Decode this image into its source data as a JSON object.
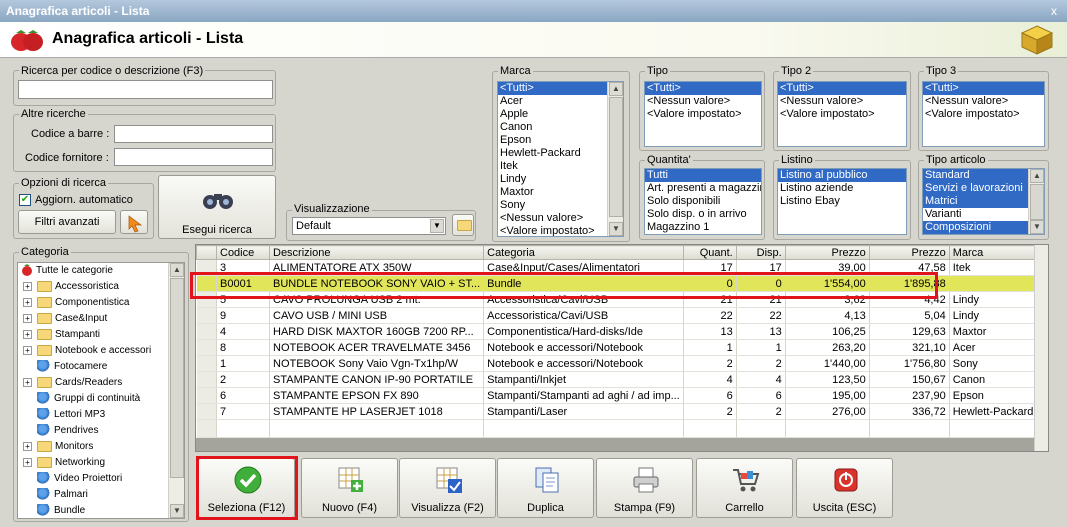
{
  "window": {
    "title": "Anagrafica articoli  - Lista",
    "close_label": "x"
  },
  "header": {
    "title": "Anagrafica articoli  - Lista"
  },
  "search": {
    "label": "Ricerca per codice o descrizione (F3)",
    "value": ""
  },
  "other_search": {
    "label": "Altre ricerche",
    "barcode_label": "Codice a barre :",
    "barcode_value": "",
    "supplier_label": "Codice fornitore :",
    "supplier_value": ""
  },
  "options": {
    "label": "Opzioni di ricerca",
    "auto_update_label": "Aggiorn. automatico",
    "auto_update_checked": true,
    "advanced_filters_label": "Filtri avanzati"
  },
  "run_search": {
    "label": "Esegui ricerca"
  },
  "view": {
    "label": "Visualizzazione",
    "selected": "Default"
  },
  "marca": {
    "label": "Marca",
    "items": [
      "<Tutti>",
      "Acer",
      "Apple",
      "Canon",
      "Epson",
      "Hewlett-Packard",
      "Itek",
      "Lindy",
      "Maxtor",
      "Sony",
      "<Nessun valore>",
      "<Valore impostato>"
    ],
    "selected_index": 0
  },
  "tipo": {
    "label": "Tipo",
    "items": [
      "<Tutti>",
      "<Nessun valore>",
      "<Valore impostato>"
    ],
    "selected_index": 0
  },
  "tipo2": {
    "label": "Tipo 2",
    "items": [
      "<Tutti>",
      "<Nessun valore>",
      "<Valore impostato>"
    ],
    "selected_index": 0
  },
  "tipo3": {
    "label": "Tipo 3",
    "items": [
      "<Tutti>",
      "<Nessun valore>",
      "<Valore impostato>"
    ],
    "selected_index": 0
  },
  "quantita": {
    "label": "Quantita'",
    "items": [
      "Tutti",
      "Art. presenti a magazzino",
      "Solo disponibili",
      "Solo disp. o in arrivo",
      "Magazzino 1"
    ],
    "selected_index": 0
  },
  "listino": {
    "label": "Listino",
    "items": [
      "Listino al pubblico",
      "Listino aziende",
      "Listino Ebay"
    ],
    "selected_index": 0
  },
  "tipo_articolo": {
    "label": "Tipo articolo",
    "items": [
      "Standard",
      "Servizi e lavorazioni",
      "Matrici",
      "Varianti",
      "Composizioni"
    ],
    "selected": [
      0,
      1,
      2,
      4
    ]
  },
  "categoria": {
    "label": "Categoria",
    "root": "Tutte le categorie",
    "items": [
      {
        "label": "Accessoristica",
        "type": "folder",
        "expandable": true
      },
      {
        "label": "Componentistica",
        "type": "folder",
        "expandable": true
      },
      {
        "label": "Case&Input",
        "type": "folder",
        "expandable": true
      },
      {
        "label": "Stampanti",
        "type": "folder",
        "expandable": true
      },
      {
        "label": "Notebook e accessori",
        "type": "folder",
        "expandable": true
      },
      {
        "label": "Fotocamere",
        "type": "net",
        "expandable": false
      },
      {
        "label": "Cards/Readers",
        "type": "folder",
        "expandable": true
      },
      {
        "label": "Gruppi di continuità",
        "type": "net",
        "expandable": false
      },
      {
        "label": "Lettori MP3",
        "type": "net",
        "expandable": false
      },
      {
        "label": "Pendrives",
        "type": "net",
        "expandable": false
      },
      {
        "label": "Monitors",
        "type": "folder",
        "expandable": true
      },
      {
        "label": "Networking",
        "type": "folder",
        "expandable": true
      },
      {
        "label": "Video Proiettori",
        "type": "net",
        "expandable": false
      },
      {
        "label": "Palmari",
        "type": "net",
        "expandable": false
      },
      {
        "label": "Bundle",
        "type": "net",
        "expandable": false
      }
    ]
  },
  "grid": {
    "columns": [
      "Codice",
      "Descrizione",
      "Categoria",
      "Quant.",
      "Disp.",
      "Prezzo",
      "Prezzo",
      "Marca"
    ],
    "rows": [
      [
        "3",
        "ALIMENTATORE ATX 350W",
        "Case&Input/Cases/Alimentatori",
        "17",
        "17",
        "39,00",
        "47,58",
        "Itek"
      ],
      [
        "B0001",
        "BUNDLE NOTEBOOK SONY VAIO + ST...",
        "Bundle",
        "0",
        "0",
        "1'554,00",
        "1'895,88",
        ""
      ],
      [
        "5",
        "CAVO PROLUNGA USB 2 mt.",
        "Accessoristica/Cavi/USB",
        "21",
        "21",
        "3,62",
        "4,42",
        "Lindy"
      ],
      [
        "9",
        "CAVO USB / MINI USB",
        "Accessoristica/Cavi/USB",
        "22",
        "22",
        "4,13",
        "5,04",
        "Lindy"
      ],
      [
        "4",
        "HARD DISK MAXTOR 160GB 7200 RP...",
        "Componentistica/Hard-disks/Ide",
        "13",
        "13",
        "106,25",
        "129,63",
        "Maxtor"
      ],
      [
        "8",
        "NOTEBOOK ACER TRAVELMATE 3456",
        "Notebook e accessori/Notebook",
        "1",
        "1",
        "263,20",
        "321,10",
        "Acer"
      ],
      [
        "1",
        "NOTEBOOK Sony Vaio Vgn-Tx1hp/W",
        "Notebook e accessori/Notebook",
        "2",
        "2",
        "1'440,00",
        "1'756,80",
        "Sony"
      ],
      [
        "2",
        "STAMPANTE CANON IP-90 PORTATILE",
        "Stampanti/Inkjet",
        "4",
        "4",
        "123,50",
        "150,67",
        "Canon"
      ],
      [
        "6",
        "STAMPANTE EPSON FX 890",
        "Stampanti/Stampanti ad aghi / ad imp...",
        "6",
        "6",
        "195,00",
        "237,90",
        "Epson"
      ],
      [
        "7",
        "STAMPANTE HP LASERJET 1018",
        "Stampanti/Laser",
        "2",
        "2",
        "276,00",
        "336,72",
        "Hewlett-Packard"
      ]
    ],
    "highlighted_row": 1
  },
  "toolbar": {
    "seleziona": "Seleziona (F12)",
    "nuovo": "Nuovo (F4)",
    "visualizza": "Visualizza (F2)",
    "duplica": "Duplica",
    "stampa": "Stampa (F9)",
    "carrello": "Carrello",
    "uscita": "Uscita (ESC)"
  },
  "colors": {
    "accent": "#316ac5",
    "highlight_row": "#e1e55a",
    "annotation_red": "#e0141a"
  }
}
